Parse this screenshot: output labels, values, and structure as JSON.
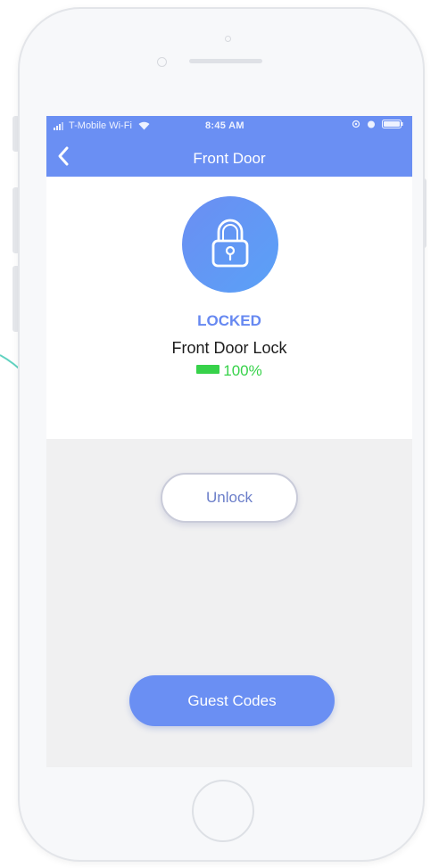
{
  "status_bar": {
    "carrier": "T-Mobile Wi-Fi",
    "time": "8:45 AM"
  },
  "nav": {
    "title": "Front Door",
    "back_icon": "chevron-left-icon"
  },
  "lock": {
    "icon": "padlock-icon",
    "state": "LOCKED",
    "name": "Front Door Lock",
    "battery_level": 100,
    "battery_text": "100%"
  },
  "actions": {
    "unlock_label": "Unlock",
    "guest_codes_label": "Guest Codes"
  },
  "colors": {
    "accent": "#6a8ff3",
    "locked_text": "#6688f1",
    "battery": "#37d24a",
    "decor_arc": "#61d2c0"
  }
}
